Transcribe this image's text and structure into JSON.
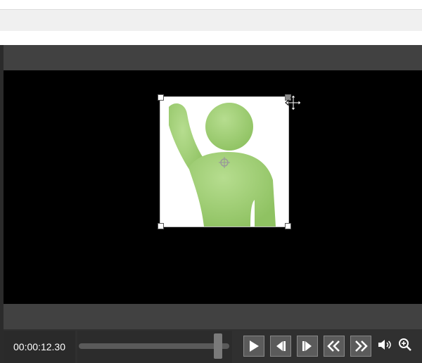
{
  "player": {
    "timecode": "00:00:12.30",
    "progress": 0.95
  },
  "icons": {
    "play": "play-icon",
    "step_back": "step-back-icon",
    "step_forward": "step-forward-icon",
    "rewind": "rewind-icon",
    "fast_forward": "fast-forward-icon",
    "volume": "volume-icon",
    "zoom": "zoom-in-icon",
    "move_cursor": "move-cursor-icon",
    "anchor": "center-anchor-icon"
  },
  "colors": {
    "figure_green": "#a3d17a",
    "canvas_bg": "#000000",
    "panel_bg": "#414141"
  }
}
